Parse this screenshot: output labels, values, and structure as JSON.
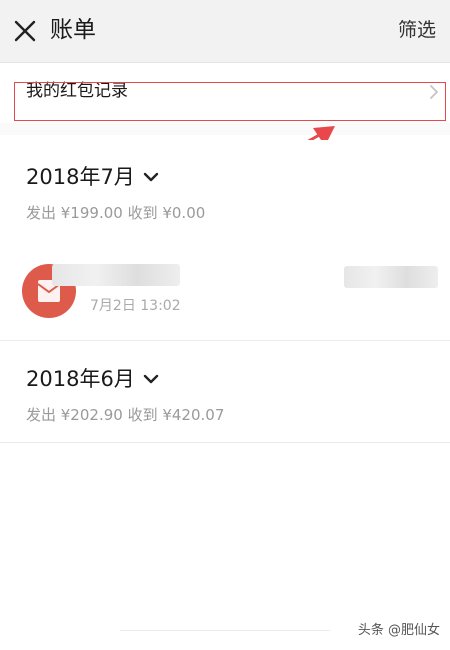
{
  "header": {
    "title": "账单",
    "filter_label": "筛选",
    "close_icon": "close-icon"
  },
  "redpacket_record": {
    "label": "我的红包记录",
    "chevron_icon": "chevron-right-icon"
  },
  "months": [
    {
      "title": "2018年7月",
      "summary": "发出 ¥199.00 收到 ¥0.00"
    },
    {
      "title": "2018年6月",
      "summary": "发出 ¥202.90 收到 ¥420.07"
    }
  ],
  "transaction": {
    "time": "7月2日 13:02",
    "icon": "red-packet-icon"
  },
  "annotation": {
    "color": "#e8474c"
  },
  "watermark": "头条 @肥仙女"
}
